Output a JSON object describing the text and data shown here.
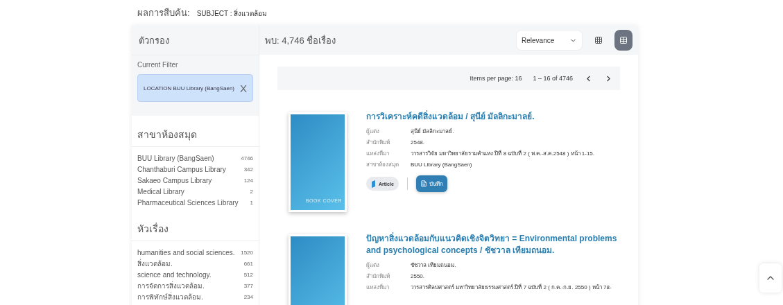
{
  "search_summary": {
    "label": "ผลการสืบค้น:",
    "query": "SUBJECT : สิ่งแวดล้อม"
  },
  "sidebar": {
    "title": "ตัวกรอง",
    "current_filter_label": "Current Filter",
    "current_filter": "LOCATION BUU Library (BangSaen)",
    "remove_symbol": "X",
    "facets": [
      {
        "title": "สาขาห้องสมุด",
        "items": [
          {
            "label": "BUU Library (BangSaen)",
            "count": "4746"
          },
          {
            "label": "Chanthaburi Campus Library",
            "count": "342"
          },
          {
            "label": "Sakaeo Campus Library",
            "count": "124"
          },
          {
            "label": "Medical Library",
            "count": "2"
          },
          {
            "label": "Pharmaceutical Sciences Library",
            "count": "1"
          }
        ]
      },
      {
        "title": "หัวเรื่อง",
        "items": [
          {
            "label": "humanities and social sciences.",
            "count": "1520"
          },
          {
            "label": "สิ่งแวดล้อม.",
            "count": "661"
          },
          {
            "label": "science and technology.",
            "count": "512"
          },
          {
            "label": "การจัดการสิ่งแวดล้อม.",
            "count": "377"
          },
          {
            "label": "การพิทักษ์สิ่งแวดล้อม.",
            "count": "234"
          }
        ]
      }
    ]
  },
  "results_header": {
    "found": "พบ: 4,746 ชื่อเรื่อง",
    "sort": "Relevance",
    "views": [
      {
        "kind": "grid",
        "selected": false
      },
      {
        "kind": "list",
        "selected": true
      }
    ]
  },
  "pagination": {
    "items_per_page": "Items per page: 16",
    "range": "1 – 16 of 4746"
  },
  "records": [
    {
      "title": "การวิเคราะห์คดีสิ่งแวดล้อม / สุนีย์ มัลลิกะมาลย์.",
      "cover_label": "BOOK COVER",
      "fields": [
        {
          "label": "ผู้แต่ง",
          "value": "สุนีย์ มัลลิกะมาลย์."
        },
        {
          "label": "สำนักพิมพ์",
          "value": "2548."
        },
        {
          "label": "แหล่งที่มา",
          "value": "วารสารวิจัย มหาวิทยาลัยรามคำแหง.ปีที่ 8 ฉบับที่ 2 ( พ.ค.-ส.ค.2548 ) หน้า 1-15."
        },
        {
          "label": "สาขาห้องสมุด",
          "value": "BUU Library (BangSaen)"
        }
      ],
      "type": "Article",
      "save": "บันทึก"
    },
    {
      "title": "ปัญหาสิ่งแวดล้อมกับแนวคิดเชิงจิตวิทยา = Environmental problems and psychological concepts / ชัชวาล เทียมถนอม.",
      "fields": [
        {
          "label": "ผู้แต่ง",
          "value": "ชัชวาล เทียมถนอม."
        },
        {
          "label": "สำนักพิมพ์",
          "value": "2550."
        },
        {
          "label": "แหล่งที่มา",
          "value": "วารสารศิลปศาสตร์ มหาวิทยาลัยธรรมศาสตร์.ปีที่ 7 ฉบับที่ 2 ( ก.ค.-ก.ย. 2550 ) หน้า 78-"
        }
      ]
    }
  ]
}
